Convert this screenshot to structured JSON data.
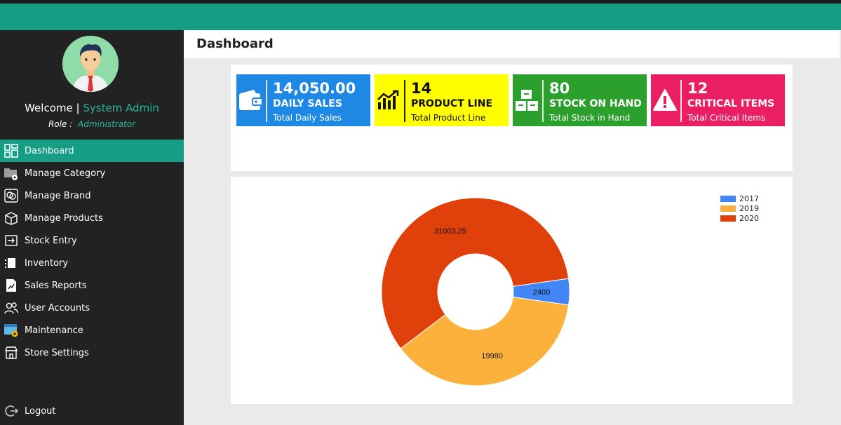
{
  "sidebar": {
    "welcome_label": "Welcome",
    "separator": "|",
    "user_name": "System Admin",
    "role_label": "Role :",
    "role_value": "Administrator",
    "items": [
      {
        "label": "Dashboard",
        "icon": "dashboard-grid-icon",
        "active": true
      },
      {
        "label": "Manage Category",
        "icon": "folder-gear-icon"
      },
      {
        "label": "Manage Brand",
        "icon": "brand-icon"
      },
      {
        "label": "Manage Products",
        "icon": "box-icon"
      },
      {
        "label": "Stock Entry",
        "icon": "stock-entry-icon"
      },
      {
        "label": "Inventory",
        "icon": "inventory-icon"
      },
      {
        "label": "Sales Reports",
        "icon": "report-icon"
      },
      {
        "label": "User Accounts",
        "icon": "users-icon"
      },
      {
        "label": "Maintenance",
        "icon": "maintenance-icon"
      },
      {
        "label": "Store Settings",
        "icon": "store-icon"
      }
    ],
    "logout_label": "Logout"
  },
  "header": {
    "title": "Dashboard"
  },
  "cards": [
    {
      "value": "14,050.00",
      "label": "DAILY SALES",
      "sub": "Total Daily Sales",
      "color": "#1e88e5",
      "icon": "wallet-icon"
    },
    {
      "value": "14",
      "label": "PRODUCT LINE",
      "sub": "Total Product Line",
      "color": "#ffff00",
      "icon": "trend-chart-icon"
    },
    {
      "value": "80",
      "label": "STOCK ON HAND",
      "sub": "Total Stock in Hand",
      "color": "#2ca02c",
      "icon": "boxes-icon"
    },
    {
      "value": "12",
      "label": "CRITICAL ITEMS",
      "sub": "Total Critical Items",
      "color": "#e91e63",
      "icon": "warning-icon"
    }
  ],
  "chart_data": {
    "type": "pie",
    "donut": true,
    "categories": [
      "2017",
      "2019",
      "2020"
    ],
    "values": [
      2400,
      19980,
      31003.25
    ],
    "colors": [
      "#4285f4",
      "#fbb13c",
      "#e0400a"
    ],
    "legend_position": "top-right"
  }
}
